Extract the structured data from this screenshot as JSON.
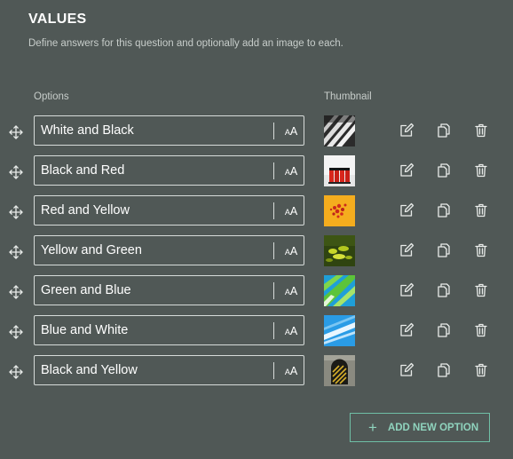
{
  "section": {
    "title": "VALUES",
    "description": "Define answers for this question and optionally add an image to each."
  },
  "columns": {
    "options": "Options",
    "thumbnail": "Thumbnail"
  },
  "text_style_label": {
    "small": "A",
    "large": "A"
  },
  "options": [
    {
      "label": "White and Black",
      "thumbnail": "white-and-black-image"
    },
    {
      "label": "Black and Red",
      "thumbnail": "black-and-red-image"
    },
    {
      "label": "Red and Yellow",
      "thumbnail": "red-and-yellow-image"
    },
    {
      "label": "Yellow and Green",
      "thumbnail": "yellow-and-green-image"
    },
    {
      "label": "Green and Blue",
      "thumbnail": "green-and-blue-image"
    },
    {
      "label": "Blue and White",
      "thumbnail": "blue-and-white-image"
    },
    {
      "label": "Black and Yellow",
      "thumbnail": "black-and-yellow-image"
    }
  ],
  "actions": {
    "icons": [
      "move-icon",
      "edit-icon",
      "copy-icon",
      "delete-icon"
    ]
  },
  "add_button": {
    "label": "ADD NEW OPTION",
    "icon": "plus-icon"
  },
  "colors": {
    "background": "#505856",
    "accent": "#8fd3bd",
    "text": "#ffffff"
  }
}
